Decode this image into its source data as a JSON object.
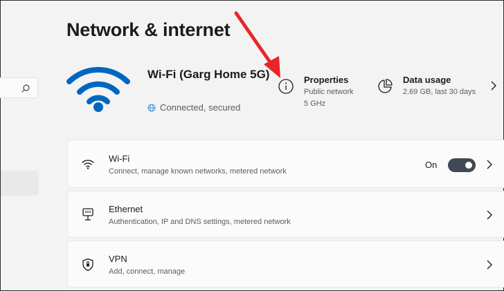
{
  "page_title": "Network & internet",
  "nav": {
    "search_icon": "search-icon"
  },
  "hero": {
    "network_name": "Wi-Fi (Garg Home 5G)",
    "status": "Connected, secured",
    "properties": {
      "title": "Properties",
      "line1": "Public network",
      "line2": "5 GHz"
    },
    "data_usage": {
      "title": "Data usage",
      "line1": "2.69 GB, last 30 days"
    }
  },
  "rows": [
    {
      "title": "Wi-Fi",
      "subtitle": "Connect, manage known networks, metered network",
      "icon": "wifi-icon",
      "toggle_label": "On",
      "toggle_on": true
    },
    {
      "title": "Ethernet",
      "subtitle": "Authentication, IP and DNS settings, metered network",
      "icon": "ethernet-icon"
    },
    {
      "title": "VPN",
      "subtitle": "Add, connect, manage",
      "icon": "vpn-shield-icon"
    }
  ],
  "colors": {
    "accent": "#0067c0",
    "annotation_arrow": "#e8262a",
    "toggle_on": "#3f4a54"
  }
}
